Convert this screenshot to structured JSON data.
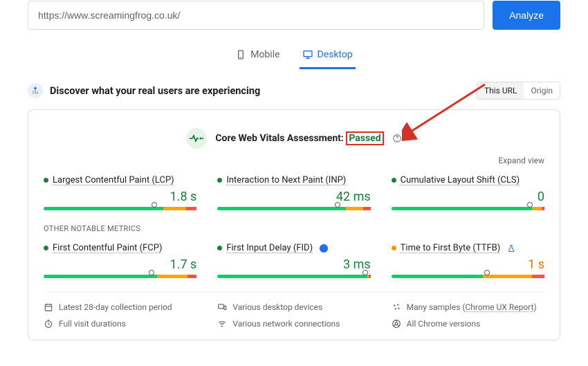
{
  "search": {
    "url": "https://www.screamingfrog.co.uk/",
    "analyze_label": "Analyze"
  },
  "tabs": {
    "mobile": "Mobile",
    "desktop": "Desktop",
    "active": "desktop"
  },
  "discover": {
    "title": "Discover what your real users are experiencing"
  },
  "toggle": {
    "this_url": "This URL",
    "origin": "Origin"
  },
  "assessment": {
    "label": "Core Web Vitals Assessment:",
    "status": "Passed"
  },
  "expand_label": "Expand view",
  "metrics": {
    "lcp": {
      "name": "Largest Contentful Paint (LCP)",
      "value": "1.8 s",
      "status": "green",
      "segs": [
        78,
        15,
        7
      ],
      "marker": 72
    },
    "inp": {
      "name": "Interaction to Next Paint (INP)",
      "value": "42 ms",
      "status": "green",
      "segs": [
        84,
        11,
        5
      ],
      "marker": 78
    },
    "cls": {
      "name": "Cumulative Layout Shift (CLS)",
      "value": "0",
      "status": "green",
      "segs": [
        92,
        6,
        2
      ],
      "marker": 90
    }
  },
  "other_label": "OTHER NOTABLE METRICS",
  "other": {
    "fcp": {
      "name": "First Contentful Paint (FCP)",
      "value": "1.7 s",
      "status": "green",
      "segs": [
        74,
        20,
        6
      ],
      "marker": 70
    },
    "fid": {
      "name": "First Input Delay (FID)",
      "value": "3 ms",
      "status": "green",
      "segs": [
        98,
        1,
        1
      ],
      "marker": 96,
      "info": true
    },
    "ttfb": {
      "name": "Time to First Byte (TTFB)",
      "value": "1 s",
      "status": "amber",
      "segs": [
        60,
        32,
        8
      ],
      "marker": 62,
      "flask": true
    }
  },
  "footer": {
    "period": "Latest 28-day collection period",
    "devices": "Various desktop devices",
    "samples_pre": "Many samples (",
    "samples_link": "Chrome UX Report",
    "samples_post": ")",
    "durations": "Full visit durations",
    "network": "Various network connections",
    "versions": "All Chrome versions"
  },
  "colors": {
    "blue": "#1a73e8",
    "green": "#188038",
    "red": "#d93025"
  }
}
